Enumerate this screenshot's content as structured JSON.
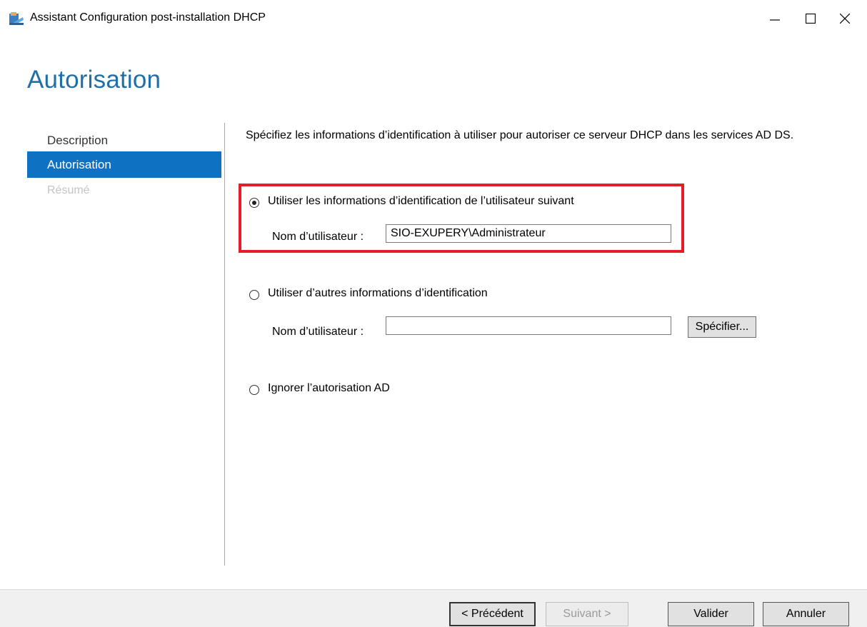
{
  "window": {
    "title": "Assistant Configuration post-installation DHCP",
    "app_icon": "dhcp-wizard-icon",
    "controls": {
      "minimize": "minimize-icon",
      "maximize": "maximize-icon",
      "close": "close-icon"
    }
  },
  "header": {
    "title": "Autorisation"
  },
  "nav": {
    "items": [
      {
        "label": "Description",
        "state": "normal"
      },
      {
        "label": "Autorisation",
        "state": "selected"
      },
      {
        "label": "Résumé",
        "state": "disabled"
      }
    ]
  },
  "main": {
    "description": "Spécifiez les informations d’identification à utiliser pour autoriser ce serveur DHCP dans les services AD DS.",
    "options": [
      {
        "label": "Utiliser les informations d’identification de l’utilisateur suivant",
        "selected": true,
        "username_label": "Nom d’utilisateur :",
        "username_value": "SIO-EXUPERY\\Administrateur"
      },
      {
        "label": "Utiliser d’autres informations d’identification",
        "selected": false,
        "username_label": "Nom d’utilisateur :",
        "username_value": "",
        "specify_label": "Spécifier..."
      },
      {
        "label": "Ignorer l’autorisation AD",
        "selected": false
      }
    ]
  },
  "footer": {
    "previous": "< Précédent",
    "next": "Suivant >",
    "validate": "Valider",
    "cancel": "Annuler"
  },
  "colors": {
    "accent": "#0f71c2",
    "heading": "#1f6fa8",
    "highlight": "#e21f26"
  }
}
